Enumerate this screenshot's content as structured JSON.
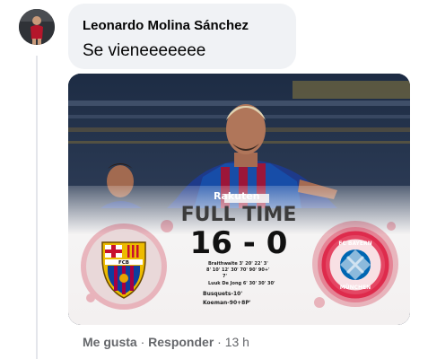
{
  "comment": {
    "author": "Leonardo Molina Sánchez",
    "text": "Se vieneeeeeee"
  },
  "attachment": {
    "headline": "FULL TIME",
    "score": "16 - 0",
    "scorers": [
      "Braithwaite 3' 20' 22' 3'",
      "8' 10' 12' 30' 70' 90' 90+'",
      "7'",
      "Luuk De Jong 6' 30' 30' 30'",
      "Busquets-10'",
      "Koeman-90+8P'"
    ],
    "sponsor": "Rakuten",
    "home_badge": "FCB",
    "away_badge_top": "FC BAYERN",
    "away_badge_bottom": "MÜNCHEN"
  },
  "actions": {
    "like": "Me gusta",
    "separator": "·",
    "reply": "Responder",
    "time": "13 h"
  },
  "colors": {
    "barca_blue": "#0e3f9e",
    "barca_red": "#a50044",
    "bayern_red": "#dc052d",
    "meta_gray": "#65676b"
  }
}
